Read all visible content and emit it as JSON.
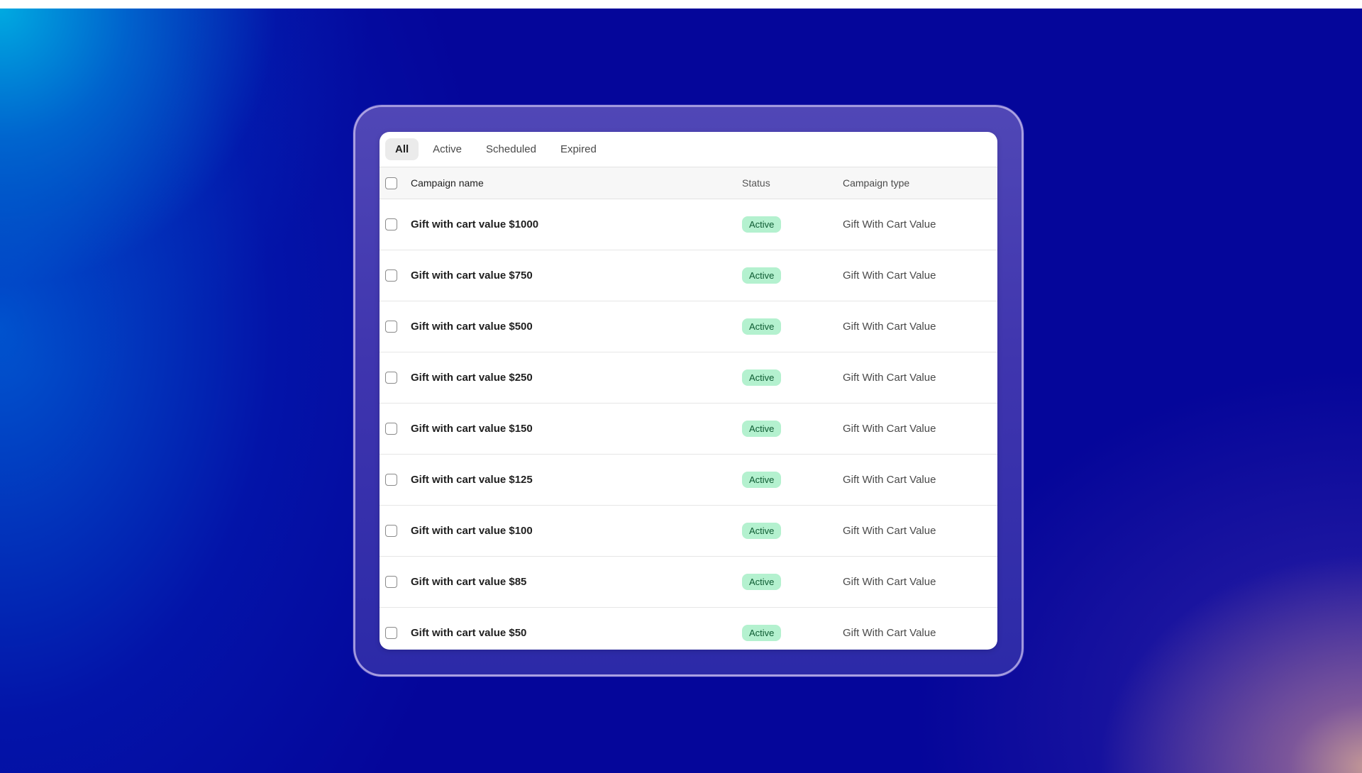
{
  "tabs": [
    {
      "label": "All"
    },
    {
      "label": "Active"
    },
    {
      "label": "Scheduled"
    },
    {
      "label": "Expired"
    }
  ],
  "table": {
    "columns": {
      "name": "Campaign name",
      "status": "Status",
      "type": "Campaign type"
    },
    "rows": [
      {
        "name": "Gift with cart value $1000",
        "status": "Active",
        "type": "Gift With Cart Value"
      },
      {
        "name": "Gift with cart value $750",
        "status": "Active",
        "type": "Gift With Cart Value"
      },
      {
        "name": "Gift with cart value $500",
        "status": "Active",
        "type": "Gift With Cart Value"
      },
      {
        "name": "Gift with cart value $250",
        "status": "Active",
        "type": "Gift With Cart Value"
      },
      {
        "name": "Gift with cart value $150",
        "status": "Active",
        "type": "Gift With Cart Value"
      },
      {
        "name": "Gift with cart value $125",
        "status": "Active",
        "type": "Gift With Cart Value"
      },
      {
        "name": "Gift with cart value $100",
        "status": "Active",
        "type": "Gift With Cart Value"
      },
      {
        "name": "Gift with cart value $85",
        "status": "Active",
        "type": "Gift With Cart Value"
      },
      {
        "name": "Gift with cart value $50",
        "status": "Active",
        "type": "Gift With Cart Value"
      }
    ]
  },
  "colors": {
    "badge_background": "#b4f1cf",
    "badge_text": "#0d5b32",
    "background_base": "#05069a",
    "frame": "#4a40b2"
  }
}
